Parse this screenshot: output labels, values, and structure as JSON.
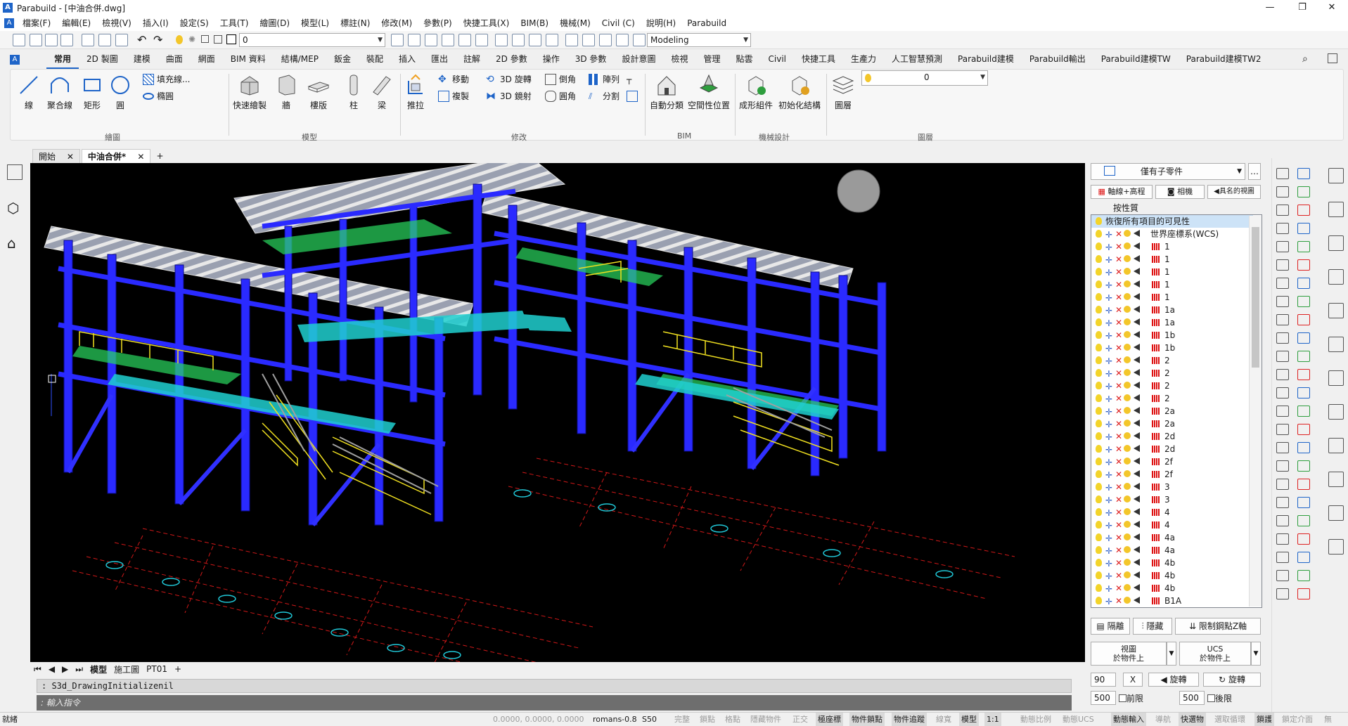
{
  "window": {
    "title": "Parabuild - [中油合併.dwg]",
    "logo": "A",
    "controls": [
      "—",
      "❐",
      "✕"
    ]
  },
  "menu": [
    "檔案(F)",
    "編輯(E)",
    "檢視(V)",
    "插入(I)",
    "設定(S)",
    "工具(T)",
    "繪圖(D)",
    "模型(L)",
    "標註(N)",
    "修改(M)",
    "參數(P)",
    "快捷工具(X)",
    "BIM(B)",
    "機械(M)",
    "Civil (C)",
    "說明(H)",
    "Parabuild"
  ],
  "quickbar": {
    "layer_value": "0",
    "workspace": "Modeling"
  },
  "ribbon_tabs": [
    "常用",
    "2D 製圖",
    "建模",
    "曲面",
    "網面",
    "BIM 資料",
    "結構/MEP",
    "鈑金",
    "裝配",
    "插入",
    "匯出",
    "註解",
    "2D 參數",
    "操作",
    "3D 參數",
    "設計意圖",
    "檢視",
    "管理",
    "點雲",
    "Civil",
    "快捷工具",
    "生產力",
    "人工智慧預測",
    "Parabuild建模",
    "Parabuild輸出",
    "Parabuild建模TW",
    "Parabuild建模TW2"
  ],
  "ribbon_active": "常用",
  "ribbon": {
    "draw": {
      "line": "線",
      "polyline": "聚合線",
      "rect": "矩形",
      "circle": "圓",
      "hatch": "填充線...",
      "ellipse": "橢圓",
      "group": "繪圖"
    },
    "model": {
      "quick": "快速繪製",
      "wall": "牆",
      "slab": "樓版",
      "column": "柱",
      "beam": "梁",
      "group": "模型"
    },
    "modify": {
      "pushpull": "推拉",
      "move": "移動",
      "rotate3d": "3D 旋轉",
      "chamfer": "倒角",
      "array": "陣列",
      "copy": "複製",
      "mirror3d": "3D 鏡射",
      "fillet": "圓角",
      "split": "分割",
      "group": "修改"
    },
    "bim": {
      "autoclass": "自動分類",
      "spatial": "空間性位置",
      "group": "BIM"
    },
    "mech": {
      "form": "成形組件",
      "init": "初始化結構",
      "group": "機械設計"
    },
    "layer": {
      "layer": "圖層",
      "value": "0",
      "group": "圖層"
    }
  },
  "doc_tabs": [
    {
      "label": "開始"
    },
    {
      "label": "中油合併*"
    }
  ],
  "layout_tabs": [
    "模型",
    "施工圖",
    "PT01",
    "+"
  ],
  "cmd": {
    "history": ": S3d_DrawingInitializenil",
    "prompt": ": 輸入指令"
  },
  "panel": {
    "filter": "僅有子零件",
    "btn_axes": "軸線+高程",
    "btn_camera": "相機",
    "btn_named": "具名的視圖",
    "sort": "按性質",
    "tree_header": "恢復所有項目的可見性",
    "wcs": "世界座標系(WCS)",
    "items": [
      "1",
      "1",
      "1",
      "1",
      "1",
      "1a",
      "1a",
      "1b",
      "1b",
      "2",
      "2",
      "2",
      "2",
      "2a",
      "2a",
      "2d",
      "2d",
      "2f",
      "2f",
      "3",
      "3",
      "4",
      "4",
      "4a",
      "4a",
      "4b",
      "4b",
      "4b",
      "B1A"
    ],
    "isolate": "隔離",
    "hide": "隱藏",
    "limit": "限制鋼點Z軸",
    "view_on": "視圖\n於物件上",
    "ucs_on": "UCS\n於物件上",
    "angle": "90",
    "axis": "X",
    "rotate": "旋轉",
    "rotate2": "旋轉",
    "front_val": "500",
    "front": "前限",
    "back_val": "500",
    "back": "後限"
  },
  "status": {
    "ready": "就緒",
    "coords": "0.0000, 0.0000, 0.0000",
    "font": "romans-0.8",
    "s50": "S50",
    "items": [
      "完整",
      "鎖點",
      "格點",
      "隱藏物件",
      "正交",
      "極座標",
      "物件鎖點",
      "物件追蹤",
      "線寬",
      "模型",
      "1:1",
      "動態比例",
      "動態UCS",
      "動態輸入",
      "導航",
      "快選物",
      "選取循環",
      "鎖護",
      "鎖定介面",
      "無"
    ]
  }
}
